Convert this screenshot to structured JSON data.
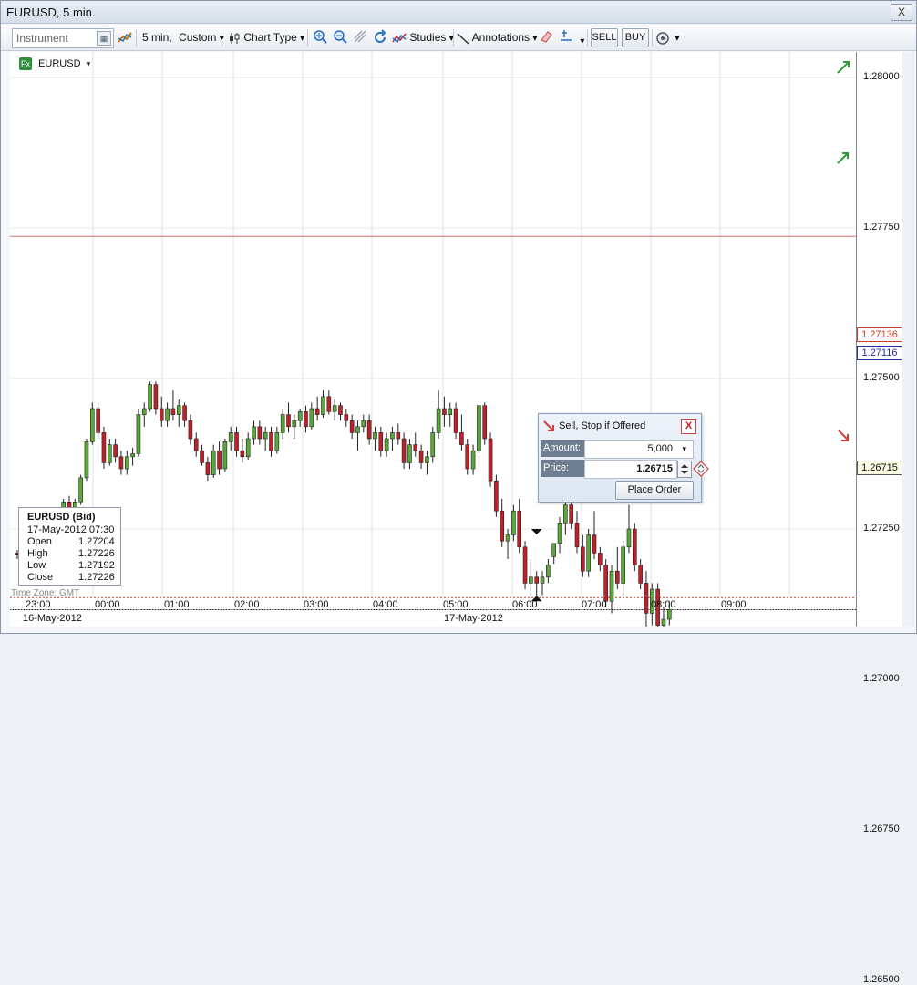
{
  "window": {
    "title": "EURUSD, 5 min.",
    "buttons": {
      "close": "X"
    }
  },
  "toolbar": {
    "instrument_placeholder": "Instrument",
    "timeframe": "5 min,",
    "timeframe_type": "Custom",
    "chart_type": "Chart Type",
    "studies": "Studies",
    "annotations": "Annotations",
    "sell": "SELL",
    "buy": "BUY",
    "dropdown_arrow": "▾"
  },
  "legend": {
    "symbol": "EURUSD",
    "icon": "Fx",
    "arrow": "▾"
  },
  "y_axis": {
    "ticks": [
      "1.28000",
      "1.27750",
      "1.27500",
      "1.27250",
      "1.27000",
      "1.26750",
      "1.26500"
    ]
  },
  "price_markers": [
    {
      "label": "1.27136",
      "color": "#d04020"
    },
    {
      "label": "1.27116",
      "color": "#2030a0"
    },
    {
      "label": "1.26715",
      "color": "#333333"
    }
  ],
  "x_axis": {
    "ticks": [
      "23:00",
      "00:00",
      "01:00",
      "02:00",
      "03:00",
      "04:00",
      "05:00",
      "06:00",
      "07:00",
      "08:00",
      "09:00"
    ],
    "dates": [
      "16-May-2012",
      "17-May-2012"
    ]
  },
  "ohlc_panel": {
    "title": "EURUSD (Bid)",
    "datetime": "17-May-2012 07:30",
    "rows": [
      {
        "label": "Open",
        "value": "1.27204"
      },
      {
        "label": "High",
        "value": "1.27226"
      },
      {
        "label": "Low",
        "value": "1.27192"
      },
      {
        "label": "Close",
        "value": "1.27226"
      }
    ]
  },
  "timezone": "Time Zone: GMT",
  "order_ticket": {
    "title": "Sell, Stop if Offered",
    "close": "X",
    "amount_label": "Amount:",
    "amount_value": "5,000",
    "price_label": "Price:",
    "price_value": "1.26715",
    "place_button": "Place Order"
  },
  "colors": {
    "up": "#5aa83a",
    "down": "#c0202a",
    "grid": "#d9dde3",
    "accent": "#2f8f3a"
  },
  "chart_data": {
    "type": "candlestick",
    "symbol": "EURUSD",
    "timeframe": "5 min",
    "x_start": "16-May-2012 23:00",
    "ylim": [
      1.2635,
      1.2815
    ],
    "horizontal_lines": [
      1.27736,
      1.27136,
      1.27116,
      1.26715
    ],
    "candles": [
      [
        1.2721,
        1.27215,
        1.272,
        1.27208
      ],
      [
        1.27208,
        1.27212,
        1.27195,
        1.272
      ],
      [
        1.272,
        1.27205,
        1.2719,
        1.27195
      ],
      [
        1.27195,
        1.272,
        1.27188,
        1.27192
      ],
      [
        1.27192,
        1.27198,
        1.27188,
        1.27195
      ],
      [
        1.27195,
        1.272,
        1.2719,
        1.27196
      ],
      [
        1.27196,
        1.27215,
        1.27192,
        1.2721
      ],
      [
        1.2721,
        1.2724,
        1.27205,
        1.2726
      ],
      [
        1.2726,
        1.273,
        1.27255,
        1.27295
      ],
      [
        1.27295,
        1.27305,
        1.2727,
        1.2728
      ],
      [
        1.2728,
        1.273,
        1.2727,
        1.27295
      ],
      [
        1.27295,
        1.2734,
        1.2729,
        1.27335
      ],
      [
        1.27335,
        1.274,
        1.2733,
        1.27395
      ],
      [
        1.27395,
        1.2746,
        1.2739,
        1.2745
      ],
      [
        1.2745,
        1.2746,
        1.274,
        1.2741
      ],
      [
        1.2741,
        1.2742,
        1.2735,
        1.2736
      ],
      [
        1.2736,
        1.274,
        1.27355,
        1.2739
      ],
      [
        1.2739,
        1.274,
        1.2736,
        1.2737
      ],
      [
        1.2737,
        1.2738,
        1.2734,
        1.2735
      ],
      [
        1.2735,
        1.2738,
        1.2734,
        1.2737
      ],
      [
        1.2737,
        1.27385,
        1.27355,
        1.27375
      ],
      [
        1.27375,
        1.2745,
        1.2737,
        1.2744
      ],
      [
        1.2744,
        1.2746,
        1.2742,
        1.2745
      ],
      [
        1.2745,
        1.27495,
        1.27445,
        1.2749
      ],
      [
        1.2749,
        1.27495,
        1.2744,
        1.2745
      ],
      [
        1.2745,
        1.2747,
        1.2742,
        1.2743
      ],
      [
        1.2743,
        1.2746,
        1.2742,
        1.2745
      ],
      [
        1.2745,
        1.2748,
        1.2743,
        1.2744
      ],
      [
        1.2744,
        1.27465,
        1.2742,
        1.27455
      ],
      [
        1.27455,
        1.2746,
        1.2742,
        1.2743
      ],
      [
        1.2743,
        1.2744,
        1.2739,
        1.274
      ],
      [
        1.274,
        1.2741,
        1.2737,
        1.2738
      ],
      [
        1.2738,
        1.2739,
        1.27355,
        1.2736
      ],
      [
        1.2736,
        1.2737,
        1.2733,
        1.2734
      ],
      [
        1.2734,
        1.2739,
        1.27335,
        1.2738
      ],
      [
        1.2738,
        1.27395,
        1.2734,
        1.2735
      ],
      [
        1.2735,
        1.274,
        1.27345,
        1.27395
      ],
      [
        1.27395,
        1.2742,
        1.2738,
        1.2741
      ],
      [
        1.2741,
        1.2742,
        1.2737,
        1.2738
      ],
      [
        1.2738,
        1.274,
        1.2736,
        1.2737
      ],
      [
        1.2737,
        1.2741,
        1.27365,
        1.274
      ],
      [
        1.274,
        1.2743,
        1.2739,
        1.2742
      ],
      [
        1.2742,
        1.2743,
        1.2739,
        1.274
      ],
      [
        1.274,
        1.2742,
        1.2738,
        1.2741
      ],
      [
        1.2741,
        1.2742,
        1.2737,
        1.2738
      ],
      [
        1.2738,
        1.2742,
        1.27375,
        1.2741
      ],
      [
        1.2741,
        1.2745,
        1.274,
        1.2744
      ],
      [
        1.2744,
        1.2746,
        1.2741,
        1.2742
      ],
      [
        1.2742,
        1.2744,
        1.274,
        1.2743
      ],
      [
        1.2743,
        1.2745,
        1.2742,
        1.27445
      ],
      [
        1.27445,
        1.27455,
        1.2741,
        1.2742
      ],
      [
        1.2742,
        1.2746,
        1.27415,
        1.2745
      ],
      [
        1.2745,
        1.2747,
        1.2743,
        1.2744
      ],
      [
        1.2744,
        1.2748,
        1.27435,
        1.2747
      ],
      [
        1.2747,
        1.2748,
        1.2744,
        1.27445
      ],
      [
        1.27445,
        1.27465,
        1.2743,
        1.27455
      ],
      [
        1.27455,
        1.2746,
        1.2743,
        1.2744
      ],
      [
        1.2744,
        1.2745,
        1.2742,
        1.2743
      ],
      [
        1.2743,
        1.2744,
        1.274,
        1.2741
      ],
      [
        1.2741,
        1.2743,
        1.2738,
        1.2742
      ],
      [
        1.2742,
        1.2744,
        1.2741,
        1.2743
      ],
      [
        1.2743,
        1.2744,
        1.2739,
        1.274
      ],
      [
        1.274,
        1.2742,
        1.2738,
        1.2741
      ],
      [
        1.2741,
        1.2742,
        1.2737,
        1.2738
      ],
      [
        1.2738,
        1.2741,
        1.2737,
        1.274
      ],
      [
        1.274,
        1.2742,
        1.2738,
        1.2741
      ],
      [
        1.2741,
        1.27425,
        1.2739,
        1.274
      ],
      [
        1.274,
        1.2741,
        1.2735,
        1.2736
      ],
      [
        1.2736,
        1.274,
        1.2735,
        1.2739
      ],
      [
        1.2739,
        1.2741,
        1.2737,
        1.2738
      ],
      [
        1.2738,
        1.2739,
        1.2735,
        1.2736
      ],
      [
        1.2736,
        1.2738,
        1.2734,
        1.2737
      ],
      [
        1.2737,
        1.2742,
        1.2736,
        1.2741
      ],
      [
        1.2741,
        1.2748,
        1.274,
        1.2745
      ],
      [
        1.2745,
        1.2747,
        1.2742,
        1.2744
      ],
      [
        1.2744,
        1.2746,
        1.2742,
        1.2745
      ],
      [
        1.2745,
        1.2746,
        1.274,
        1.2741
      ],
      [
        1.2741,
        1.2744,
        1.2738,
        1.2739
      ],
      [
        1.2739,
        1.274,
        1.2734,
        1.2735
      ],
      [
        1.2735,
        1.2739,
        1.2734,
        1.2738
      ],
      [
        1.2738,
        1.2746,
        1.27375,
        1.27455
      ],
      [
        1.27455,
        1.2746,
        1.2739,
        1.274
      ],
      [
        1.274,
        1.2741,
        1.2732,
        1.2733
      ],
      [
        1.2733,
        1.2734,
        1.2727,
        1.2728
      ],
      [
        1.2728,
        1.273,
        1.2722,
        1.2723
      ],
      [
        1.2723,
        1.2725,
        1.272,
        1.2724
      ],
      [
        1.2724,
        1.2729,
        1.2723,
        1.2728
      ],
      [
        1.2728,
        1.273,
        1.2721,
        1.2722
      ],
      [
        1.2722,
        1.2723,
        1.2715,
        1.2716
      ],
      [
        1.2716,
        1.272,
        1.2714,
        1.2717
      ],
      [
        1.2717,
        1.2718,
        1.2713,
        1.2716
      ],
      [
        1.2716,
        1.2718,
        1.2714,
        1.2717
      ],
      [
        1.2717,
        1.272,
        1.2716,
        1.2719
      ],
      [
        1.27204,
        1.27226,
        1.27192,
        1.27226
      ],
      [
        1.27226,
        1.2727,
        1.2721,
        1.2726
      ],
      [
        1.2726,
        1.273,
        1.2724,
        1.2729
      ],
      [
        1.2729,
        1.2734,
        1.2725,
        1.2726
      ],
      [
        1.2726,
        1.2728,
        1.2721,
        1.2722
      ],
      [
        1.2722,
        1.2724,
        1.2717,
        1.2718
      ],
      [
        1.2718,
        1.2725,
        1.2717,
        1.2724
      ],
      [
        1.2724,
        1.2728,
        1.272,
        1.2721
      ],
      [
        1.2721,
        1.2722,
        1.2718,
        1.2719
      ],
      [
        1.2719,
        1.272,
        1.2712,
        1.2713
      ],
      [
        1.2713,
        1.2719,
        1.2711,
        1.2718
      ],
      [
        1.2718,
        1.2722,
        1.2715,
        1.2716
      ],
      [
        1.2716,
        1.2723,
        1.2714,
        1.2722
      ],
      [
        1.2722,
        1.2729,
        1.2721,
        1.2725
      ],
      [
        1.2725,
        1.2726,
        1.2718,
        1.2719
      ],
      [
        1.2719,
        1.272,
        1.2715,
        1.2716
      ],
      [
        1.2716,
        1.2718,
        1.2707,
        1.2711
      ],
      [
        1.2711,
        1.2716,
        1.2709,
        1.2715
      ],
      [
        1.2715,
        1.2716,
        1.2708,
        1.2709
      ],
      [
        1.2709,
        1.2712,
        1.2703,
        1.271
      ],
      [
        1.271,
        1.2713,
        1.2709,
        1.27116
      ]
    ]
  }
}
